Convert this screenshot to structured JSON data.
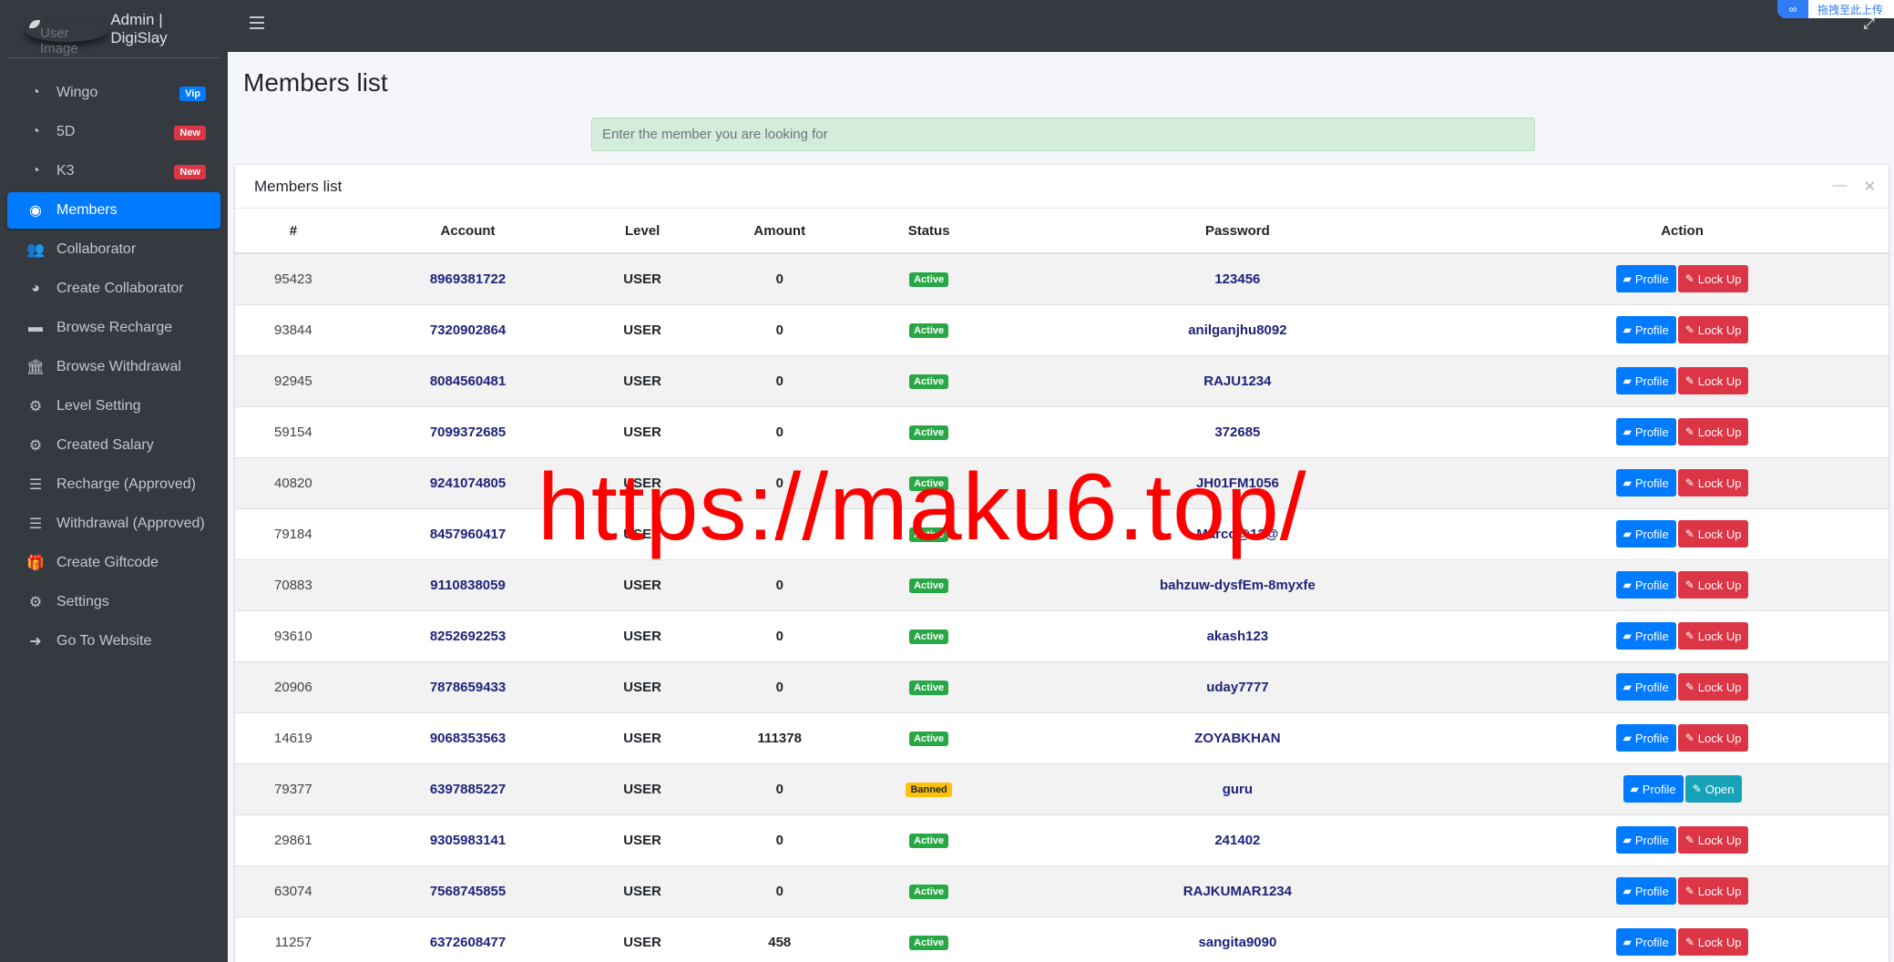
{
  "brand": {
    "logo_alt": "User Image",
    "title": "Admin | DigiSlay"
  },
  "sidebar": {
    "items": [
      {
        "label": "Wingo",
        "icon": "dashboard-gauge-icon",
        "badge": "Vip"
      },
      {
        "label": "5D",
        "icon": "dashboard-gauge-icon",
        "badge": "New"
      },
      {
        "label": "K3",
        "icon": "dashboard-gauge-icon",
        "badge": "New"
      },
      {
        "label": "Members",
        "icon": "user-circle-icon",
        "active": true
      },
      {
        "label": "Collaborator",
        "icon": "users-icon"
      },
      {
        "label": "Create Collaborator",
        "icon": "pie-chart-icon"
      },
      {
        "label": "Browse Recharge",
        "icon": "credit-card-icon"
      },
      {
        "label": "Browse Withdrawal",
        "icon": "bank-icon"
      },
      {
        "label": "Level Setting",
        "icon": "cogs-icon"
      },
      {
        "label": "Created Salary",
        "icon": "cogs-icon"
      },
      {
        "label": "Recharge (Approved)",
        "icon": "list-icon"
      },
      {
        "label": "Withdrawal (Approved)",
        "icon": "list-icon"
      },
      {
        "label": "Create Giftcode",
        "icon": "gift-icon"
      },
      {
        "label": "Settings",
        "icon": "gear-icon"
      },
      {
        "label": "Go To Website",
        "icon": "sign-out-icon"
      }
    ]
  },
  "topbar": {
    "extension_label": "拖拽至此上传"
  },
  "page": {
    "title": "Members list",
    "search_placeholder": "Enter the member you are looking for",
    "card_title": "Members list"
  },
  "table": {
    "columns": [
      "#",
      "Account",
      "Level",
      "Amount",
      "Status",
      "Password",
      "Action"
    ],
    "rows": [
      {
        "id": "95423",
        "account": "8969381722",
        "level": "USER",
        "amount": "0",
        "status": "Active",
        "password": "123456",
        "actions": [
          "Profile",
          "Lock Up"
        ]
      },
      {
        "id": "93844",
        "account": "7320902864",
        "level": "USER",
        "amount": "0",
        "status": "Active",
        "password": "anilganjhu8092",
        "actions": [
          "Profile",
          "Lock Up"
        ]
      },
      {
        "id": "92945",
        "account": "8084560481",
        "level": "USER",
        "amount": "0",
        "status": "Active",
        "password": "RAJU1234",
        "actions": [
          "Profile",
          "Lock Up"
        ]
      },
      {
        "id": "59154",
        "account": "7099372685",
        "level": "USER",
        "amount": "0",
        "status": "Active",
        "password": "372685",
        "actions": [
          "Profile",
          "Lock Up"
        ]
      },
      {
        "id": "40820",
        "account": "9241074805",
        "level": "USER",
        "amount": "0",
        "status": "Active",
        "password": "JH01FM1056",
        "actions": [
          "Profile",
          "Lock Up"
        ]
      },
      {
        "id": "79184",
        "account": "8457960417",
        "level": "USER",
        "amount": "0",
        "status": "Active",
        "password": "Marco@12@",
        "actions": [
          "Profile",
          "Lock Up"
        ]
      },
      {
        "id": "70883",
        "account": "9110838059",
        "level": "USER",
        "amount": "0",
        "status": "Active",
        "password": "bahzuw-dysfEm-8myxfe",
        "actions": [
          "Profile",
          "Lock Up"
        ]
      },
      {
        "id": "93610",
        "account": "8252692253",
        "level": "USER",
        "amount": "0",
        "status": "Active",
        "password": "akash123",
        "actions": [
          "Profile",
          "Lock Up"
        ]
      },
      {
        "id": "20906",
        "account": "7878659433",
        "level": "USER",
        "amount": "0",
        "status": "Active",
        "password": "uday7777",
        "actions": [
          "Profile",
          "Lock Up"
        ]
      },
      {
        "id": "14619",
        "account": "9068353563",
        "level": "USER",
        "amount": "111378",
        "status": "Active",
        "password": "ZOYABKHAN",
        "actions": [
          "Profile",
          "Lock Up"
        ]
      },
      {
        "id": "79377",
        "account": "6397885227",
        "level": "USER",
        "amount": "0",
        "status": "Banned",
        "password": "guru",
        "actions": [
          "Profile",
          "Open"
        ]
      },
      {
        "id": "29861",
        "account": "9305983141",
        "level": "USER",
        "amount": "0",
        "status": "Active",
        "password": "241402",
        "actions": [
          "Profile",
          "Lock Up"
        ]
      },
      {
        "id": "63074",
        "account": "7568745855",
        "level": "USER",
        "amount": "0",
        "status": "Active",
        "password": "RAJKUMAR1234",
        "actions": [
          "Profile",
          "Lock Up"
        ]
      },
      {
        "id": "11257",
        "account": "6372608477",
        "level": "USER",
        "amount": "458",
        "status": "Active",
        "password": "sangita9090",
        "actions": [
          "Profile",
          "Lock Up"
        ]
      }
    ]
  },
  "watermark": {
    "text": "https://maku6.top/"
  }
}
